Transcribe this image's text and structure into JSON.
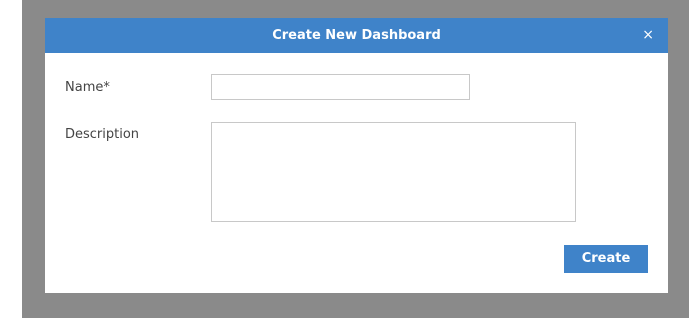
{
  "dialog": {
    "title": "Create New Dashboard",
    "close_icon": "close-icon",
    "close_glyph": "×"
  },
  "form": {
    "name_label": "Name*",
    "name_value": "",
    "description_label": "Description",
    "description_value": ""
  },
  "actions": {
    "create_label": "Create"
  },
  "colors": {
    "header": "#3f83c9",
    "button": "#3f83c9",
    "overlay": "#8a8a8a"
  }
}
